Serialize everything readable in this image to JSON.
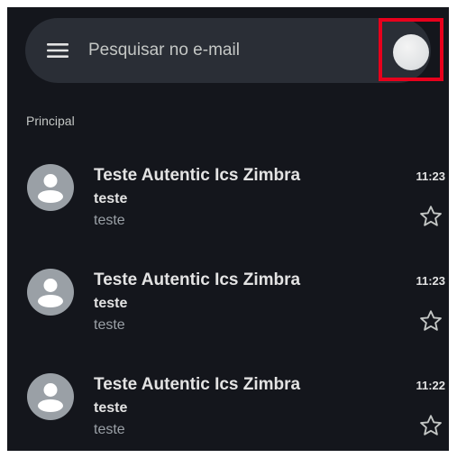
{
  "search": {
    "placeholder": "Pesquisar no e-mail"
  },
  "icons": {
    "menu": "hamburger-menu-icon",
    "account": "account-avatar",
    "contact": "person-icon",
    "star": "star-outline-icon"
  },
  "colors": {
    "background": "#14161c",
    "search_bar": "#2a2e36",
    "primary_text": "#e3e3e3",
    "secondary_text": "#9aa0a6",
    "highlight": "#e8001c"
  },
  "section": {
    "label": "Principal"
  },
  "emails": [
    {
      "sender": "Teste Autentic Ics Zimbra",
      "subject": "teste",
      "snippet": "teste",
      "time": "11:23",
      "starred": false
    },
    {
      "sender": "Teste Autentic Ics Zimbra",
      "subject": "teste",
      "snippet": "teste",
      "time": "11:23",
      "starred": false
    },
    {
      "sender": "Teste Autentic Ics Zimbra",
      "subject": "teste",
      "snippet": "teste",
      "time": "11:22",
      "starred": false
    }
  ]
}
